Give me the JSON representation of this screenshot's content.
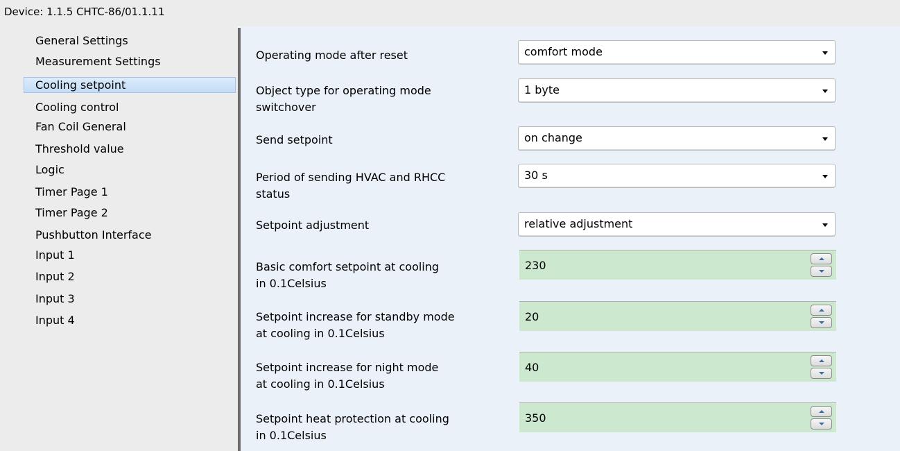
{
  "device": {
    "title": "Device: 1.1.5  CHTC-86/01.1.11"
  },
  "nav": {
    "items": [
      {
        "label": "General Settings"
      },
      {
        "label": "Measurement Settings"
      },
      {
        "label": "Cooling setpoint",
        "selected": true
      },
      {
        "label": "Cooling control"
      },
      {
        "label": "Fan Coil General"
      },
      {
        "label": "Threshold value"
      },
      {
        "label": "Logic"
      },
      {
        "label": "Timer Page 1"
      },
      {
        "label": "Timer Page 2"
      },
      {
        "label": "Pushbutton Interface"
      },
      {
        "label": "Input 1"
      },
      {
        "label": "Input 2"
      },
      {
        "label": "Input 3"
      },
      {
        "label": "Input 4"
      }
    ]
  },
  "params": {
    "operating_mode": {
      "label": "Operating mode after reset",
      "value": "comfort mode"
    },
    "object_type": {
      "label_line1": "Object type for operating mode",
      "label_line2": "switchover",
      "value": "1 byte"
    },
    "send_setpoint": {
      "label": "Send setpoint",
      "value": "on change"
    },
    "period_sending": {
      "label_line1": "Period of sending HVAC and RHCC",
      "label_line2": "status",
      "value": "30 s"
    },
    "setpoint_adjustment": {
      "label": "Setpoint adjustment",
      "value": "relative adjustment"
    },
    "basic_comfort": {
      "label_line1": "Basic comfort setpoint at cooling",
      "label_line2": "in 0.1Celsius",
      "value": "230"
    },
    "standby_increase": {
      "label_line1": "Setpoint increase for standby mode",
      "label_line2": "at cooling in 0.1Celsius",
      "value": "20"
    },
    "night_increase": {
      "label_line1": "Setpoint increase for night mode",
      "label_line2": "at cooling in 0.1Celsius",
      "value": "40"
    },
    "heat_protection": {
      "label_line1": "Setpoint heat protection at cooling",
      "label_line2": "in 0.1Celsius",
      "value": "350"
    }
  },
  "colors": {
    "panel_bg": "#ececec",
    "content_bg": "#eaf1f8",
    "spin_bg": "#cce8cf",
    "selection": "#c3dcf5"
  }
}
